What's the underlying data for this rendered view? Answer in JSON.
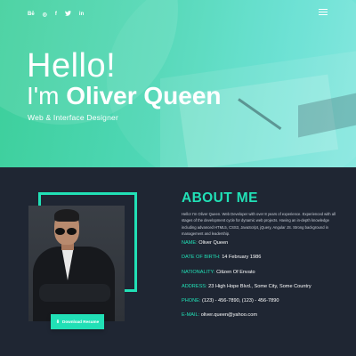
{
  "header": {
    "social_icons": [
      {
        "name": "behance-icon",
        "glyph": "Bē"
      },
      {
        "name": "dribbble-icon",
        "glyph": "◎"
      },
      {
        "name": "facebook-icon",
        "glyph": "f"
      },
      {
        "name": "twitter-icon",
        "glyph": "🐦"
      },
      {
        "name": "linkedin-icon",
        "glyph": "in"
      }
    ],
    "menu_icon": "hamburger-menu-icon"
  },
  "hero": {
    "greeting": "Hello!",
    "intro": "I'm",
    "name": "Oliver Queen",
    "role": "Web & Interface Designer"
  },
  "about": {
    "title": "ABOUT ME",
    "bio": "Hello! I'm Oliver Queen. Web Developer with over 8 years of experience. Experienced with all stages of the development cycle for dynamic web projects. Having an in-depth knowledge including advanced HTML5, CSS3, JavaScript, jQuery, Angular JS. Strong background in management and leadership.",
    "details": [
      {
        "label": "NAME:",
        "value": "Oliver Queen"
      },
      {
        "label": "DATE OF BIRTH:",
        "value": "14 February 1986"
      },
      {
        "label": "NATIONALITY:",
        "value": "Citizen Of Envato"
      },
      {
        "label": "ADDRESS:",
        "value": "23 High Hope Blvd., Some City, Some Country"
      },
      {
        "label": "PHONE:",
        "value": "(123) - 456-7890, (123) - 456-7890"
      },
      {
        "label": "E-MAIL:",
        "value": "oliver.queen@yahoo.com"
      }
    ],
    "download_button": "Download Resume",
    "download_icon": "download-icon"
  },
  "colors": {
    "accent": "#21e0b6",
    "background_dark": "#1f2633",
    "hero_gradient_start": "#3ccf9a",
    "hero_gradient_end": "#7de6dd"
  }
}
